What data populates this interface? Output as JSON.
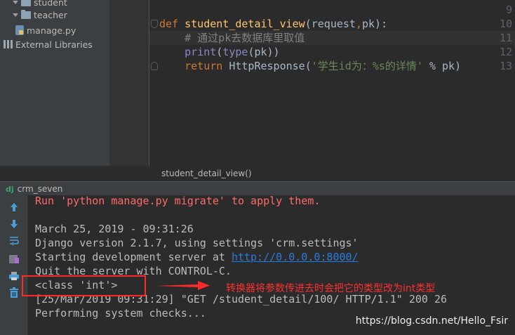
{
  "project_tree": {
    "items": [
      {
        "label": "student",
        "icon": "folder-icon"
      },
      {
        "label": "teacher",
        "icon": "folder-icon"
      },
      {
        "label": "manage.py",
        "icon": "python-file-icon"
      },
      {
        "label": "External Libraries",
        "icon": "libraries-icon"
      }
    ]
  },
  "editor": {
    "line_numbers": [
      "9",
      "10",
      "11",
      "12",
      "13"
    ],
    "code": {
      "l10": {
        "kw": "def",
        "fn": "student_detail_view",
        "rest": "(request",
        "comma": ",",
        "rest2": "pk):"
      },
      "l11": "# 通过pk去数据库里取值",
      "l12": {
        "builtin1": "print",
        "p1": "(",
        "builtin2": "type",
        "p2": "(pk))"
      },
      "l13": {
        "kw": "return",
        "mid": " HttpResponse(",
        "str": "'学生id为：%s的详情'",
        "end": " % pk)"
      }
    }
  },
  "breadcrumb": "student_detail_view()",
  "run_tab": {
    "icon": "dj",
    "label": "crm_seven"
  },
  "toolbar": [
    "up-arrow-icon",
    "down-arrow-icon",
    "soft-wrap-icon",
    "scroll-to-end-icon",
    "print-icon",
    "trash-icon"
  ],
  "console": {
    "lines": [
      {
        "text": "Run 'python manage.py migrate' to apply them.",
        "type": "err"
      },
      {
        "text": "",
        "type": "out"
      },
      {
        "text": "March 25, 2019 - 09:31:26",
        "type": "out"
      },
      {
        "text": "Django version 2.1.7, using settings 'crm.settings'",
        "type": "out"
      },
      {
        "text": "Starting development server at ",
        "type": "out",
        "link": "http://0.0.0.0:8000/"
      },
      {
        "text": "Quit the server with CONTROL-C.",
        "type": "out"
      },
      {
        "text": "<class 'int'>",
        "type": "out"
      },
      {
        "text": "[25/Mar/2019 09:31:29] \"GET /student_detail/100/ HTTP/1.1\" 200 26",
        "type": "out"
      },
      {
        "text": "Performing system checks...",
        "type": "out"
      }
    ]
  },
  "annotation": "转换器将参数传进去时会把它的类型改为int类型",
  "watermark": "https://blog.csdn.net/Hello_Fsir",
  "colors": {
    "keyword": "#cc7832",
    "function": "#ffc66d",
    "builtin": "#8888c6",
    "string": "#6a8759",
    "comment": "#808080",
    "error": "#ff6b68",
    "link": "#287bde",
    "annotation": "#ff2a2a"
  }
}
